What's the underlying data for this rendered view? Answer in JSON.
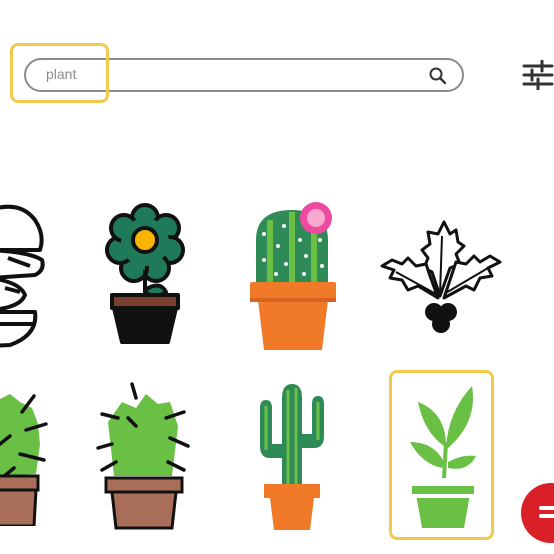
{
  "search": {
    "value": "plant",
    "placeholder": ""
  },
  "icons": [
    "outline-potted-plant-icon",
    "flower-pot-icon",
    "cactus-with-pink-flower-icon",
    "holly-leaves-icon",
    "round-cactus-icon",
    "spiky-cactus-pot-icon",
    "saguaro-cactus-icon",
    "green-sprout-pot-icon"
  ],
  "colors": {
    "highlight": "#f2c94c",
    "fab": "#d92027",
    "cactus_green": "#2e8b57",
    "light_green": "#6abf45",
    "pot_orange": "#f07a28",
    "pot_brown": "#a86e5a"
  }
}
